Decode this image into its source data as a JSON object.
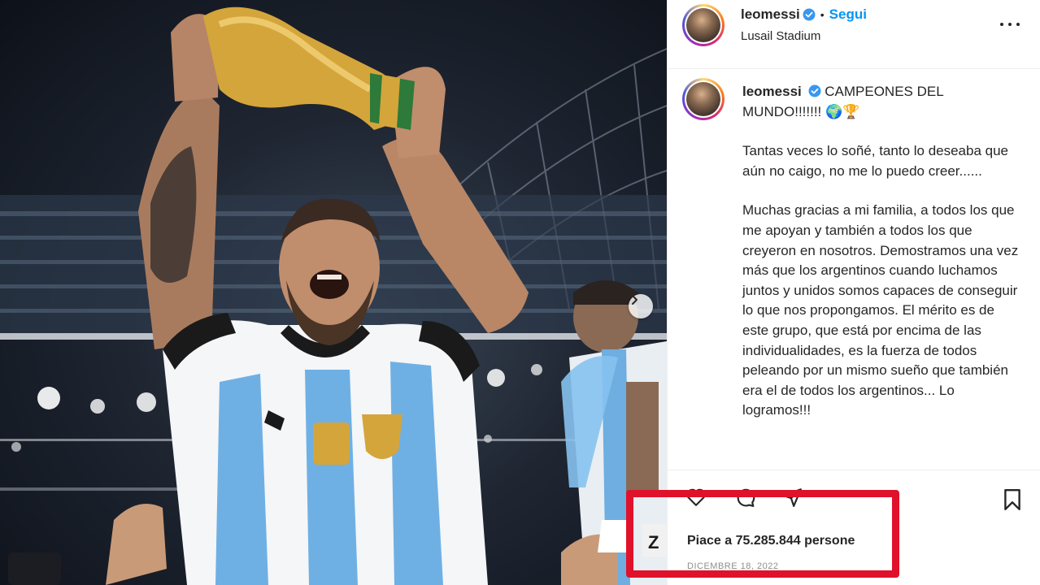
{
  "post": {
    "username": "leomessi",
    "follow_label": "Segui",
    "location": "Lusail Stadium",
    "caption_headline": "CAMPEONES DEL MUNDO!!!!!!! 🌍🏆",
    "caption_paragraphs": [
      "Tantas veces lo soñé, tanto lo deseaba que aún no caigo, no me lo puedo creer......",
      "Muchas gracias a mi familia, a todos los que me apoyan y también a todos los que creyeron en nosotros. Demostramos una vez más que los argentinos cuando luchamos juntos y unidos somos capaces de conseguir lo que nos propongamos. El mérito es de este grupo, que está por encima de las individualidades, es la fuerza de todos peleando por un mismo sueño que también era el de todos los argentinos... Lo logramos!!!"
    ],
    "likes_label": "Piace a 75.285.844 persone",
    "date_label": "DICEMBRE 18, 2022"
  },
  "colors": {
    "accent": "#0095f6",
    "verified": "#3897f0",
    "annotation": "#e0112b",
    "text": "#262626"
  },
  "icons": {
    "more": "more-horizontal-icon",
    "verified": "verified-badge-icon",
    "next": "chevron-right-icon",
    "like": "heart-icon",
    "comment": "comment-icon",
    "share": "send-icon",
    "save": "bookmark-icon"
  }
}
